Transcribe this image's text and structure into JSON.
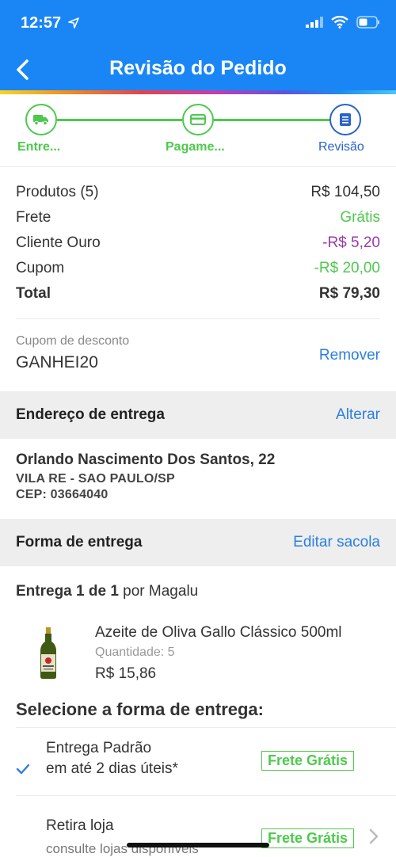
{
  "status_bar": {
    "time": "12:57"
  },
  "header": {
    "title": "Revisão do Pedido"
  },
  "steps": [
    {
      "label": "Entre..."
    },
    {
      "label": "Pagame..."
    },
    {
      "label": "Revisão"
    }
  ],
  "summary": {
    "products_label": "Produtos (5)",
    "products_value": "R$ 104,50",
    "shipping_label": "Frete",
    "shipping_value": "Grátis",
    "gold_label": "Cliente Ouro",
    "gold_value": "-R$ 5,20",
    "coupon_label": "Cupom",
    "coupon_value": "-R$ 20,00",
    "total_label": "Total",
    "total_value": "R$ 79,30"
  },
  "coupon": {
    "label": "Cupom de desconto",
    "code": "GANHEI20",
    "remove": "Remover"
  },
  "address_section": {
    "title": "Endereço de entrega",
    "action": "Alterar"
  },
  "address": {
    "line1": "Orlando Nascimento Dos Santos, 22",
    "line2": "VILA RE - SAO PAULO/SP",
    "line3": "CEP: 03664040"
  },
  "delivery_section": {
    "title": "Forma de entrega",
    "action": "Editar sacola"
  },
  "delivery": {
    "count": "Entrega 1 de 1",
    "seller": "por Magalu"
  },
  "product": {
    "name": "Azeite de Oliva Gallo Clássico 500ml",
    "quantity": "Quantidade: 5",
    "price": "R$ 15,86"
  },
  "shipping_options": {
    "title": "Selecione a forma de entrega:",
    "standard": {
      "title": "Entrega Padrão",
      "subtitle": "em até 2 dias úteis*",
      "badge": "Frete Grátis"
    },
    "pickup": {
      "title": "Retira loja",
      "subtitle": "consulte lojas disponíveis",
      "badge": "Frete Grátis"
    }
  },
  "colors": {
    "primary": "#1a86f5",
    "green": "#4ec94e",
    "purple": "#9a3aa8",
    "link": "#2b7fe0",
    "active_step": "#2a63c9"
  }
}
